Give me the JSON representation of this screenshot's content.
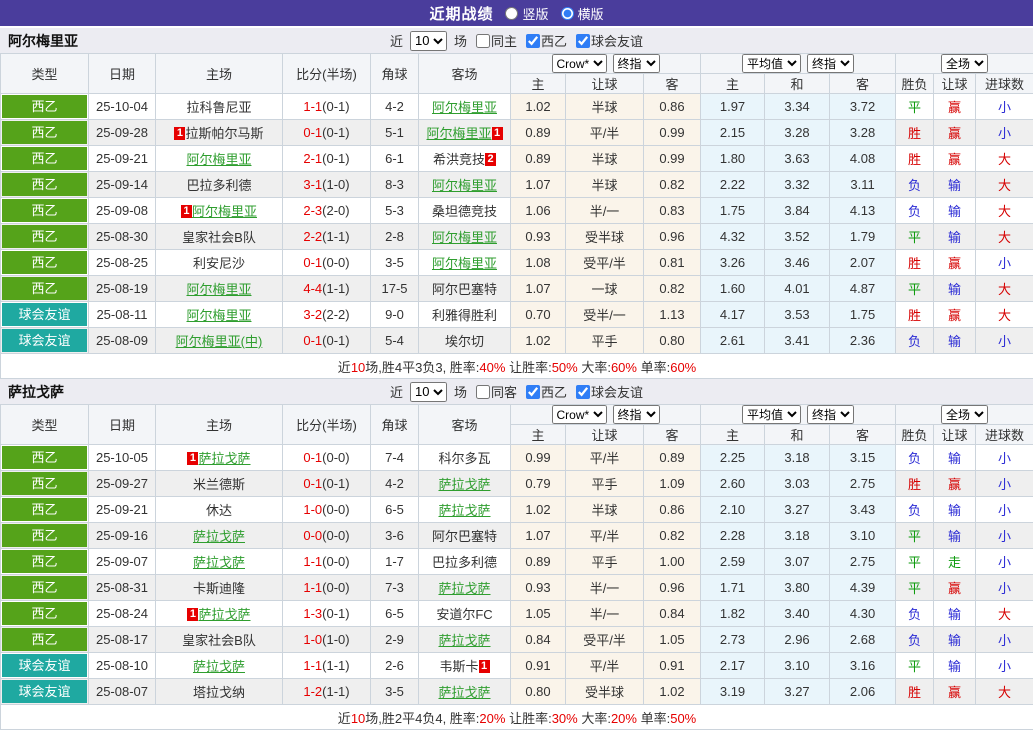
{
  "topbar": {
    "title": "近期战绩",
    "radios": [
      {
        "label": "竖版",
        "selected": false
      },
      {
        "label": "横版",
        "selected": true
      }
    ]
  },
  "columns": {
    "type": "类型",
    "date": "日期",
    "home": "主场",
    "score": "比分(半场)",
    "corner": "角球",
    "away": "客场",
    "sub": [
      "主",
      "让球",
      "客",
      "主",
      "和",
      "客",
      "胜负",
      "让球",
      "进球数"
    ]
  },
  "selects": {
    "odds_source": "Crow*",
    "odds_final": "终指",
    "avg": "平均值",
    "avg_final": "终指",
    "scope": "全场"
  },
  "colors": {
    "topbar": "#4a3d9c",
    "league_green": "#55a31a",
    "friendly_teal": "#1fa9a1",
    "team_highlight": "#2f9e2f",
    "score_red": "#e60000",
    "win_red": "#d60000",
    "draw_green": "#0b9a0b",
    "lose_blue": "#2b2bd5",
    "odds_bg": "#faf4ea",
    "avg_bg": "#e9f5fb"
  },
  "type_color_map": {
    "西乙": "bg-green",
    "球会友谊": "bg-teal"
  },
  "result_color_map": {
    "胜": "res-red",
    "平": "res-green",
    "负": "res-blue",
    "赢": "res-red",
    "走": "res-green",
    "输": "res-blue",
    "大": "res-red",
    "小": "res-blue"
  },
  "sections": [
    {
      "team": "阿尔梅里亚",
      "filter": {
        "near": "近",
        "count": "10",
        "games": "场",
        "same_label": "同主",
        "same_checked": false,
        "league_label": "西乙",
        "league_checked": true,
        "friendly_label": "球会友谊",
        "friendly_checked": true
      },
      "rows": [
        {
          "type": "西乙",
          "date": "25-10-04",
          "home": "拉科鲁尼亚",
          "home_hl": false,
          "home_card": "",
          "score": "1-1",
          "half": "0-1",
          "corner": "4-2",
          "away": "阿尔梅里亚",
          "away_hl": true,
          "away_card": "",
          "crown": [
            "1.02",
            "半球",
            "0.86"
          ],
          "avg": [
            "1.97",
            "3.34",
            "3.72"
          ],
          "result": [
            "平",
            "赢",
            "小"
          ]
        },
        {
          "type": "西乙",
          "date": "25-09-28",
          "home": "拉斯帕尔马斯",
          "home_hl": false,
          "home_card": "1",
          "score": "0-1",
          "half": "0-1",
          "corner": "5-1",
          "away": "阿尔梅里亚",
          "away_hl": true,
          "away_card": "1",
          "crown": [
            "0.89",
            "平/半",
            "0.99"
          ],
          "avg": [
            "2.15",
            "3.28",
            "3.28"
          ],
          "result": [
            "胜",
            "赢",
            "小"
          ]
        },
        {
          "type": "西乙",
          "date": "25-09-21",
          "home": "阿尔梅里亚",
          "home_hl": true,
          "home_card": "",
          "score": "2-1",
          "half": "0-1",
          "corner": "6-1",
          "away": "希洪竞技",
          "away_hl": false,
          "away_card": "2",
          "crown": [
            "0.89",
            "半球",
            "0.99"
          ],
          "avg": [
            "1.80",
            "3.63",
            "4.08"
          ],
          "result": [
            "胜",
            "赢",
            "大"
          ]
        },
        {
          "type": "西乙",
          "date": "25-09-14",
          "home": "巴拉多利德",
          "home_hl": false,
          "home_card": "",
          "score": "3-1",
          "half": "1-0",
          "corner": "8-3",
          "away": "阿尔梅里亚",
          "away_hl": true,
          "away_card": "",
          "crown": [
            "1.07",
            "半球",
            "0.82"
          ],
          "avg": [
            "2.22",
            "3.32",
            "3.11"
          ],
          "result": [
            "负",
            "输",
            "大"
          ]
        },
        {
          "type": "西乙",
          "date": "25-09-08",
          "home": "阿尔梅里亚",
          "home_hl": true,
          "home_card": "1",
          "score": "2-3",
          "half": "2-0",
          "corner": "5-3",
          "away": "桑坦德竞技",
          "away_hl": false,
          "away_card": "",
          "crown": [
            "1.06",
            "半/一",
            "0.83"
          ],
          "avg": [
            "1.75",
            "3.84",
            "4.13"
          ],
          "result": [
            "负",
            "输",
            "大"
          ]
        },
        {
          "type": "西乙",
          "date": "25-08-30",
          "home": "皇家社会B队",
          "home_hl": false,
          "home_card": "",
          "score": "2-2",
          "half": "1-1",
          "corner": "2-8",
          "away": "阿尔梅里亚",
          "away_hl": true,
          "away_card": "",
          "crown": [
            "0.93",
            "受半球",
            "0.96"
          ],
          "avg": [
            "4.32",
            "3.52",
            "1.79"
          ],
          "result": [
            "平",
            "输",
            "大"
          ]
        },
        {
          "type": "西乙",
          "date": "25-08-25",
          "home": "利安尼沙",
          "home_hl": false,
          "home_card": "",
          "score": "0-1",
          "half": "0-0",
          "corner": "3-5",
          "away": "阿尔梅里亚",
          "away_hl": true,
          "away_card": "",
          "crown": [
            "1.08",
            "受平/半",
            "0.81"
          ],
          "avg": [
            "3.26",
            "3.46",
            "2.07"
          ],
          "result": [
            "胜",
            "赢",
            "小"
          ]
        },
        {
          "type": "西乙",
          "date": "25-08-19",
          "home": "阿尔梅里亚",
          "home_hl": true,
          "home_card": "",
          "score": "4-4",
          "half": "1-1",
          "corner": "17-5",
          "away": "阿尔巴塞特",
          "away_hl": false,
          "away_card": "",
          "crown": [
            "1.07",
            "一球",
            "0.82"
          ],
          "avg": [
            "1.60",
            "4.01",
            "4.87"
          ],
          "result": [
            "平",
            "输",
            "大"
          ]
        },
        {
          "type": "球会友谊",
          "date": "25-08-11",
          "home": "阿尔梅里亚",
          "home_hl": true,
          "home_card": "",
          "score": "3-2",
          "half": "2-2",
          "corner": "9-0",
          "away": "利雅得胜利",
          "away_hl": false,
          "away_card": "",
          "crown": [
            "0.70",
            "受半/一",
            "1.13"
          ],
          "avg": [
            "4.17",
            "3.53",
            "1.75"
          ],
          "result": [
            "胜",
            "赢",
            "大"
          ]
        },
        {
          "type": "球会友谊",
          "date": "25-08-09",
          "home": "阿尔梅里亚(中)",
          "home_hl": true,
          "home_card": "",
          "score": "0-1",
          "half": "0-1",
          "corner": "5-4",
          "away": "埃尔切",
          "away_hl": false,
          "away_card": "",
          "crown": [
            "1.02",
            "平手",
            "0.80"
          ],
          "avg": [
            "2.61",
            "3.41",
            "2.36"
          ],
          "result": [
            "负",
            "输",
            "小"
          ]
        }
      ],
      "summary": [
        [
          "近",
          "k"
        ],
        [
          "10",
          "r"
        ],
        [
          "场,胜4平3负3, 胜率:",
          "k"
        ],
        [
          "40%",
          "r"
        ],
        [
          " 让胜率:",
          "k"
        ],
        [
          "50%",
          "r"
        ],
        [
          " 大率:",
          "k"
        ],
        [
          "60%",
          "r"
        ],
        [
          " 单率:",
          "k"
        ],
        [
          "60%",
          "r"
        ]
      ]
    },
    {
      "team": "萨拉戈萨",
      "filter": {
        "near": "近",
        "count": "10",
        "games": "场",
        "same_label": "同客",
        "same_checked": false,
        "league_label": "西乙",
        "league_checked": true,
        "friendly_label": "球会友谊",
        "friendly_checked": true
      },
      "rows": [
        {
          "type": "西乙",
          "date": "25-10-05",
          "home": "萨拉戈萨",
          "home_hl": true,
          "home_card": "1",
          "score": "0-1",
          "half": "0-0",
          "corner": "7-4",
          "away": "科尔多瓦",
          "away_hl": false,
          "away_card": "",
          "crown": [
            "0.99",
            "平/半",
            "0.89"
          ],
          "avg": [
            "2.25",
            "3.18",
            "3.15"
          ],
          "result": [
            "负",
            "输",
            "小"
          ]
        },
        {
          "type": "西乙",
          "date": "25-09-27",
          "home": "米兰德斯",
          "home_hl": false,
          "home_card": "",
          "score": "0-1",
          "half": "0-1",
          "corner": "4-2",
          "away": "萨拉戈萨",
          "away_hl": true,
          "away_card": "",
          "crown": [
            "0.79",
            "平手",
            "1.09"
          ],
          "avg": [
            "2.60",
            "3.03",
            "2.75"
          ],
          "result": [
            "胜",
            "赢",
            "小"
          ]
        },
        {
          "type": "西乙",
          "date": "25-09-21",
          "home": "休达",
          "home_hl": false,
          "home_card": "",
          "score": "1-0",
          "half": "0-0",
          "corner": "6-5",
          "away": "萨拉戈萨",
          "away_hl": true,
          "away_card": "",
          "crown": [
            "1.02",
            "半球",
            "0.86"
          ],
          "avg": [
            "2.10",
            "3.27",
            "3.43"
          ],
          "result": [
            "负",
            "输",
            "小"
          ]
        },
        {
          "type": "西乙",
          "date": "25-09-16",
          "home": "萨拉戈萨",
          "home_hl": true,
          "home_card": "",
          "score": "0-0",
          "half": "0-0",
          "corner": "3-6",
          "away": "阿尔巴塞特",
          "away_hl": false,
          "away_card": "",
          "crown": [
            "1.07",
            "平/半",
            "0.82"
          ],
          "avg": [
            "2.28",
            "3.18",
            "3.10"
          ],
          "result": [
            "平",
            "输",
            "小"
          ]
        },
        {
          "type": "西乙",
          "date": "25-09-07",
          "home": "萨拉戈萨",
          "home_hl": true,
          "home_card": "",
          "score": "1-1",
          "half": "0-0",
          "corner": "1-7",
          "away": "巴拉多利德",
          "away_hl": false,
          "away_card": "",
          "crown": [
            "0.89",
            "平手",
            "1.00"
          ],
          "avg": [
            "2.59",
            "3.07",
            "2.75"
          ],
          "result": [
            "平",
            "走",
            "小"
          ]
        },
        {
          "type": "西乙",
          "date": "25-08-31",
          "home": "卡斯迪隆",
          "home_hl": false,
          "home_card": "",
          "score": "1-1",
          "half": "0-0",
          "corner": "7-3",
          "away": "萨拉戈萨",
          "away_hl": true,
          "away_card": "",
          "crown": [
            "0.93",
            "半/一",
            "0.96"
          ],
          "avg": [
            "1.71",
            "3.80",
            "4.39"
          ],
          "result": [
            "平",
            "赢",
            "小"
          ]
        },
        {
          "type": "西乙",
          "date": "25-08-24",
          "home": "萨拉戈萨",
          "home_hl": true,
          "home_card": "1",
          "score": "1-3",
          "half": "0-1",
          "corner": "6-5",
          "away": "安道尔FC",
          "away_hl": false,
          "away_card": "",
          "crown": [
            "1.05",
            "半/一",
            "0.84"
          ],
          "avg": [
            "1.82",
            "3.40",
            "4.30"
          ],
          "result": [
            "负",
            "输",
            "大"
          ]
        },
        {
          "type": "西乙",
          "date": "25-08-17",
          "home": "皇家社会B队",
          "home_hl": false,
          "home_card": "",
          "score": "1-0",
          "half": "1-0",
          "corner": "2-9",
          "away": "萨拉戈萨",
          "away_hl": true,
          "away_card": "",
          "crown": [
            "0.84",
            "受平/半",
            "1.05"
          ],
          "avg": [
            "2.73",
            "2.96",
            "2.68"
          ],
          "result": [
            "负",
            "输",
            "小"
          ]
        },
        {
          "type": "球会友谊",
          "date": "25-08-10",
          "home": "萨拉戈萨",
          "home_hl": true,
          "home_card": "",
          "score": "1-1",
          "half": "1-1",
          "corner": "2-6",
          "away": "韦斯卡",
          "away_hl": false,
          "away_card": "1",
          "crown": [
            "0.91",
            "平/半",
            "0.91"
          ],
          "avg": [
            "2.17",
            "3.10",
            "3.16"
          ],
          "result": [
            "平",
            "输",
            "小"
          ]
        },
        {
          "type": "球会友谊",
          "date": "25-08-07",
          "home": "塔拉戈纳",
          "home_hl": false,
          "home_card": "",
          "score": "1-2",
          "half": "1-1",
          "corner": "3-5",
          "away": "萨拉戈萨",
          "away_hl": true,
          "away_card": "",
          "crown": [
            "0.80",
            "受半球",
            "1.02"
          ],
          "avg": [
            "3.19",
            "3.27",
            "2.06"
          ],
          "result": [
            "胜",
            "赢",
            "大"
          ]
        }
      ],
      "summary": [
        [
          "近",
          "k"
        ],
        [
          "10",
          "r"
        ],
        [
          "场,胜2平4负4, 胜率:",
          "k"
        ],
        [
          "20%",
          "r"
        ],
        [
          " 让胜率:",
          "k"
        ],
        [
          "30%",
          "r"
        ],
        [
          " 大率:",
          "k"
        ],
        [
          "20%",
          "r"
        ],
        [
          " 单率:",
          "k"
        ],
        [
          "50%",
          "r"
        ]
      ]
    }
  ]
}
